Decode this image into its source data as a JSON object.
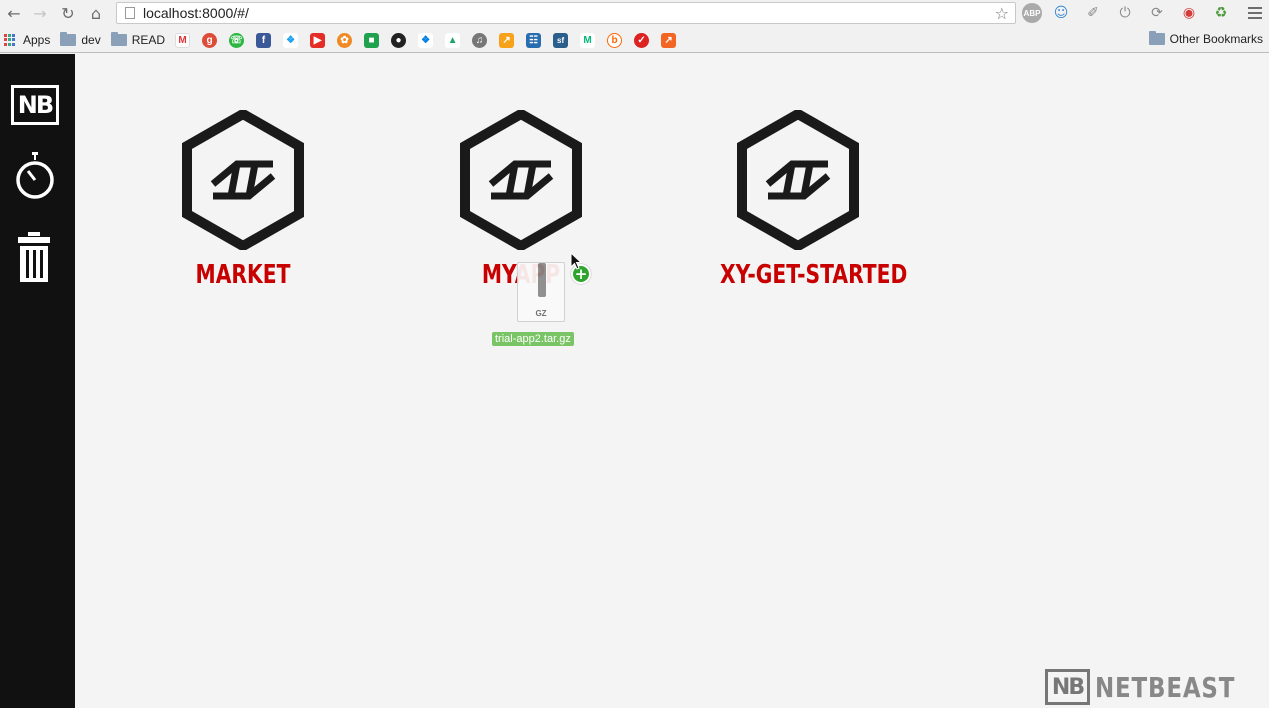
{
  "browser": {
    "url": "localhost:8000/#/",
    "bookmarks": {
      "apps_label": "Apps",
      "folders": [
        "dev",
        "READ"
      ],
      "favicons": [
        "gmail-icon",
        "google-plus-icon",
        "whatsapp-icon",
        "facebook-icon",
        "twitter-icon",
        "youtube-icon",
        "orange-circle-icon",
        "green-square-icon",
        "github-icon",
        "dropbox-icon",
        "google-drive-icon",
        "audio-icon",
        "chart-icon",
        "stack-icon",
        "sf-icon",
        "medium-icon",
        "orange-b-icon",
        "red-check-icon",
        "orange-chart-icon"
      ],
      "other_label": "Other Bookmarks"
    },
    "extensions": [
      "abp-icon",
      "smiley-icon",
      "eyedropper-icon",
      "power-icon",
      "sync-icon",
      "red-wave-icon",
      "recycle-icon"
    ],
    "abp_text": "ABP"
  },
  "sidebar": {
    "logo_text": "NB",
    "items": [
      "timer-icon",
      "trash-icon"
    ]
  },
  "apps": [
    {
      "label": "MARKET"
    },
    {
      "label": "MYAPP"
    },
    {
      "label": "XY-GET-STARTED"
    }
  ],
  "drag": {
    "file_name": "trial-app2.tar.gz",
    "file_type": "GZ",
    "badge": "+"
  },
  "footer": {
    "logo_text": "NB",
    "brand": "NETBEAST"
  },
  "colors": {
    "app_label": "#c80000",
    "sidebar": "#111111",
    "background": "#f4f4f4"
  }
}
